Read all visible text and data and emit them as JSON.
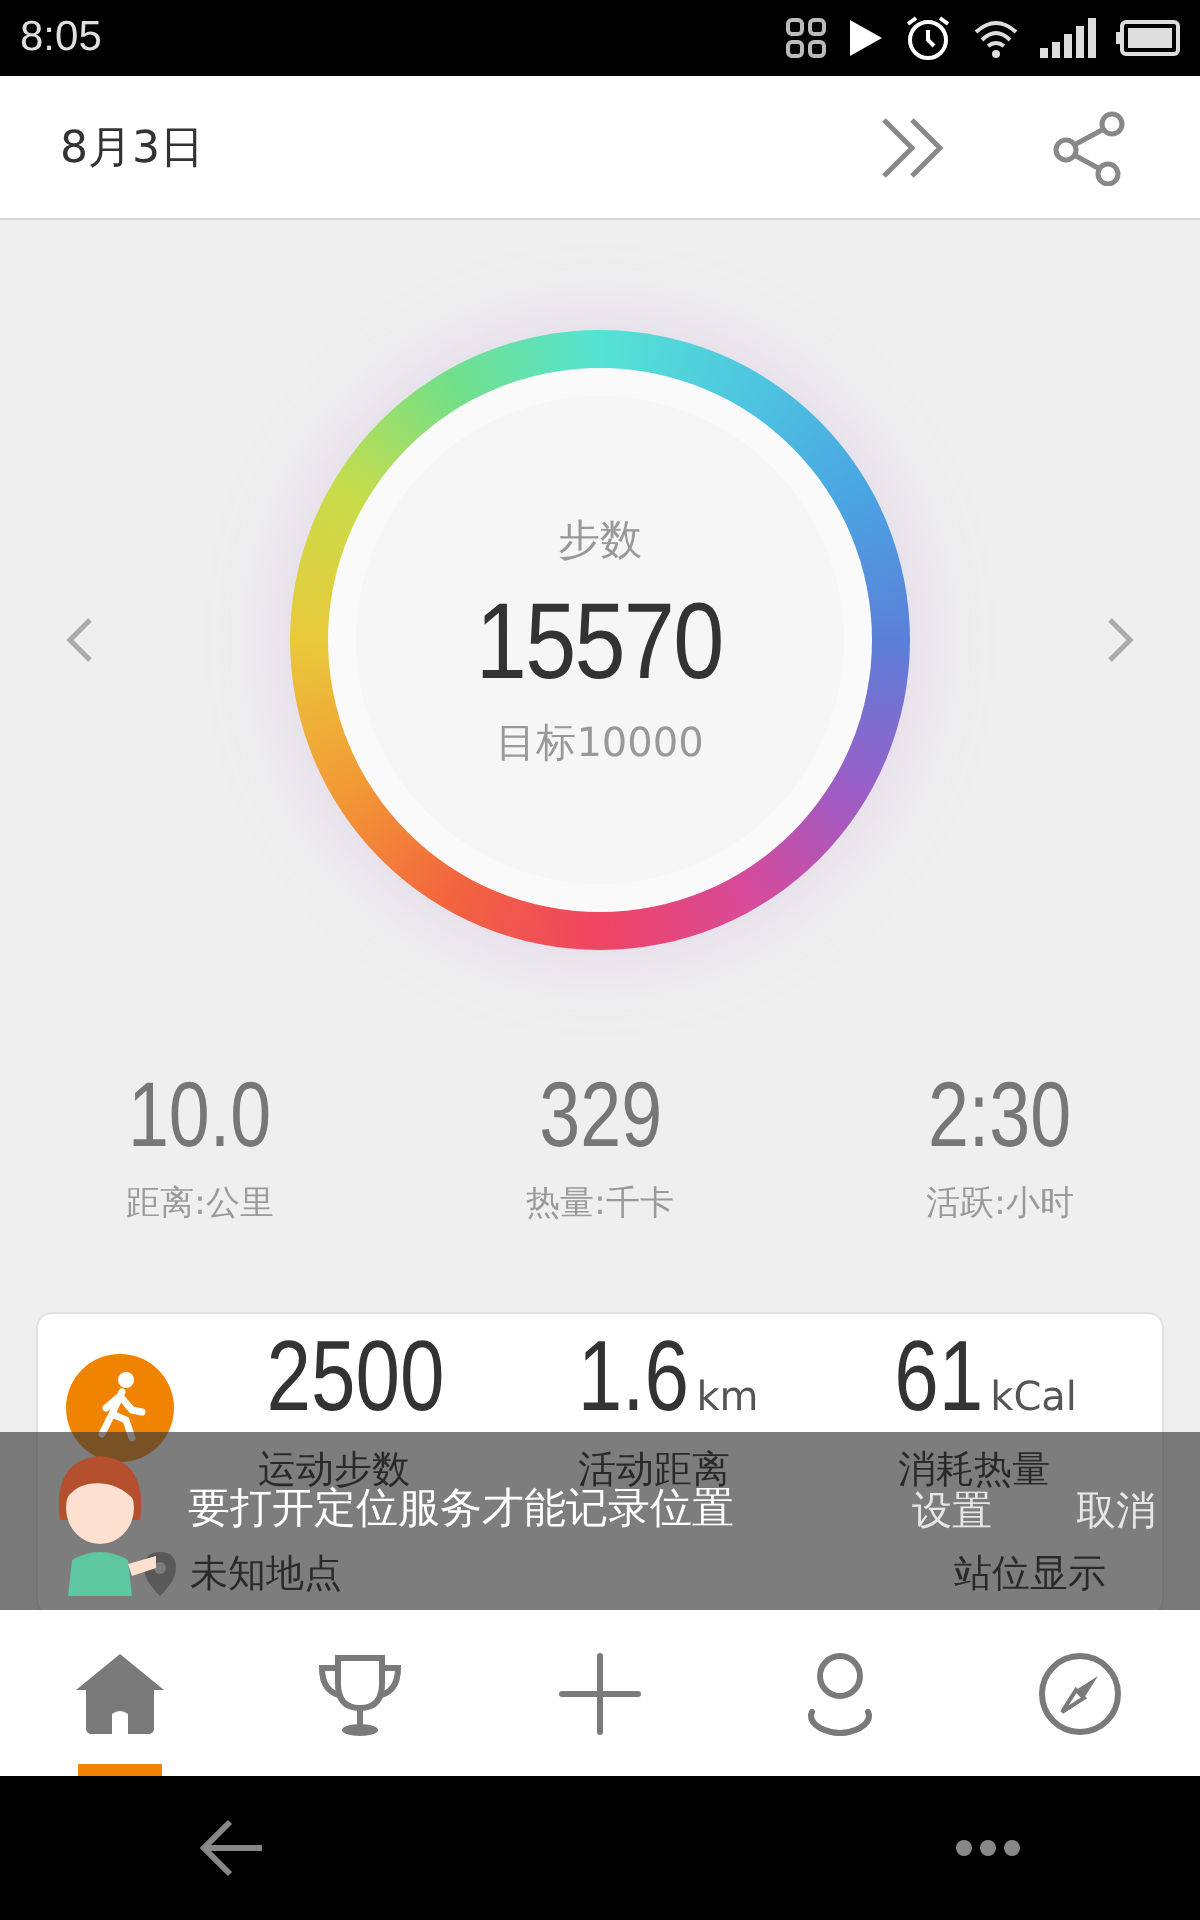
{
  "status_bar": {
    "time": "8:05"
  },
  "header": {
    "date": "8月3日"
  },
  "ring": {
    "label": "步数",
    "steps": "15570",
    "goal": "目标10000"
  },
  "stats": [
    {
      "value": "10.0",
      "label": "距离:公里"
    },
    {
      "value": "329",
      "label": "热量:千卡"
    },
    {
      "value": "2:30",
      "label": "活跃:小时"
    }
  ],
  "activity_card": {
    "metrics": [
      {
        "value": "2500",
        "label": "运动步数"
      },
      {
        "value": "1.6",
        "unit": "km",
        "label": "活动距离"
      },
      {
        "value": "61",
        "unit": "kCal",
        "label": "消耗热量"
      }
    ],
    "location": "未知地点",
    "location_action": "站位显示"
  },
  "toast": {
    "message": "要打开定位服务才能记录位置",
    "actions": [
      "设置",
      "取消"
    ]
  },
  "tabs": [
    {
      "kind": "home",
      "selected": true
    },
    {
      "kind": "trophy",
      "selected": false
    },
    {
      "kind": "add",
      "selected": false
    },
    {
      "kind": "profile",
      "selected": false
    },
    {
      "kind": "compass",
      "selected": false
    }
  ]
}
